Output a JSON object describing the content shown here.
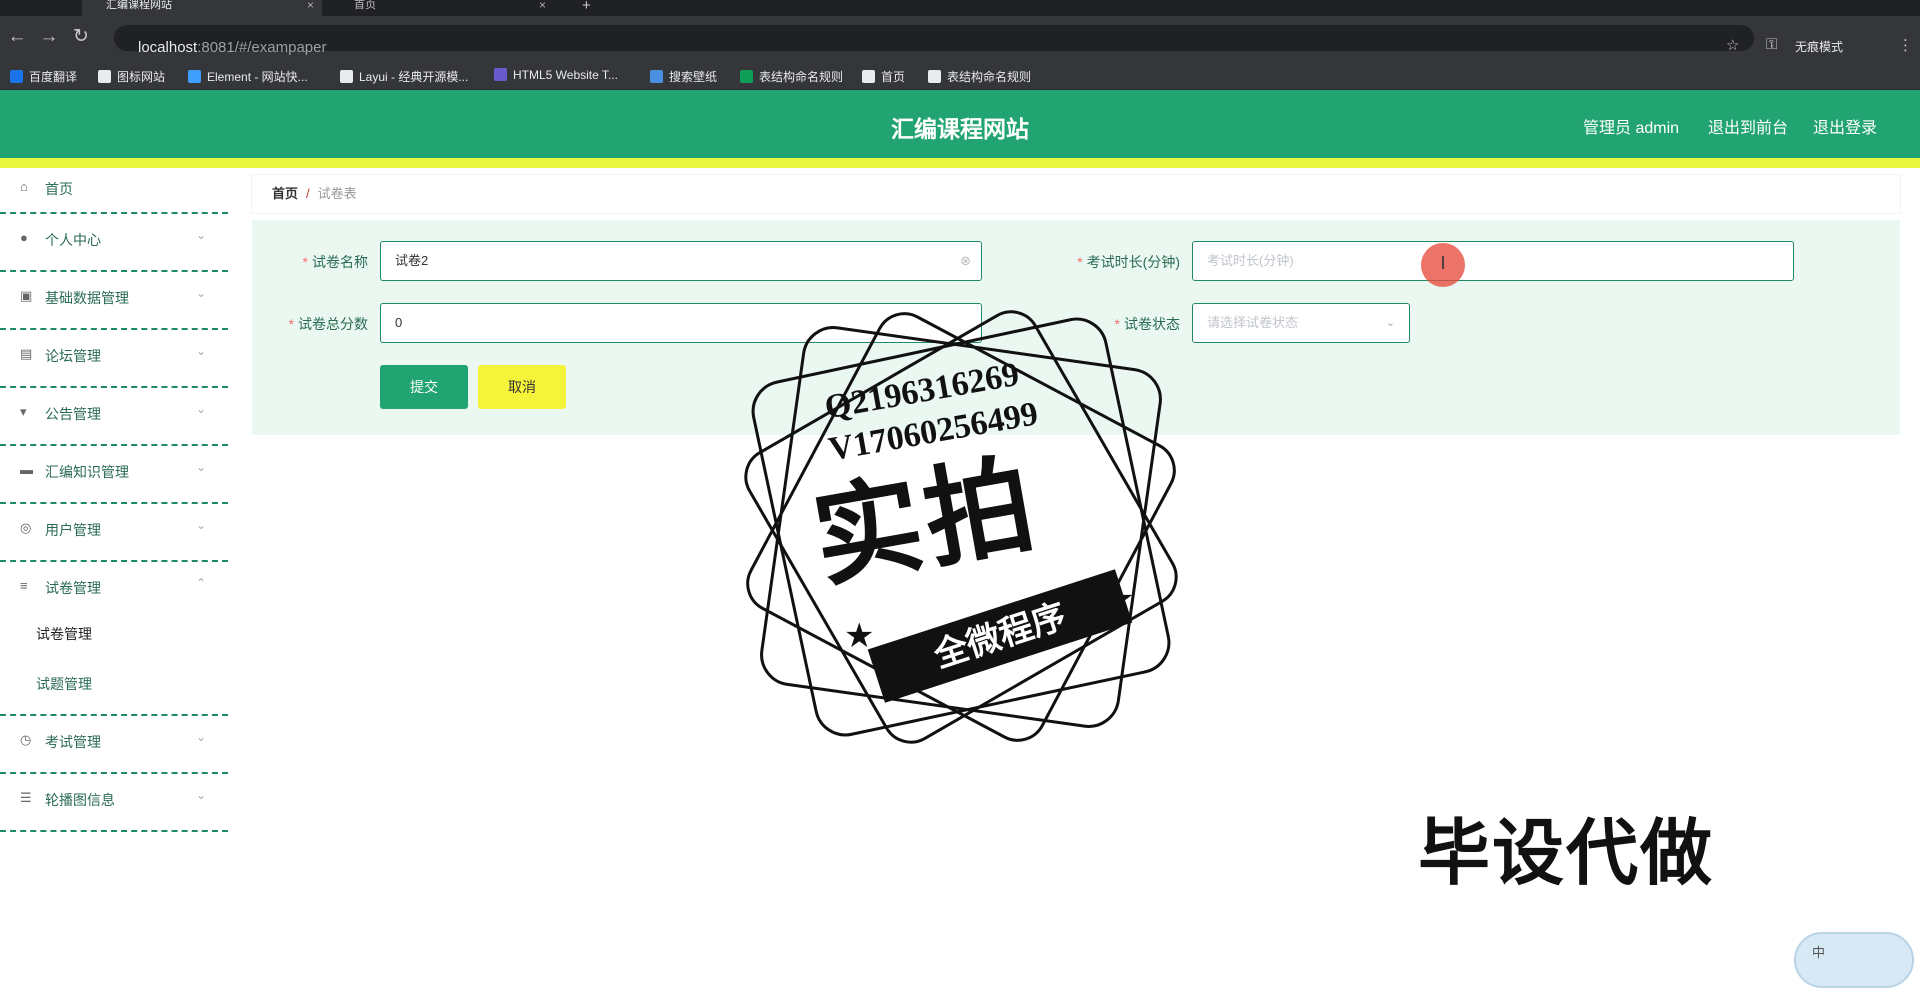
{
  "browser": {
    "tabs": [
      {
        "label": "汇编课程网站",
        "active": true
      },
      {
        "label": "首页",
        "active": false
      }
    ],
    "url_host": "localhost",
    "url_path": ":8081/#/exampaper",
    "incognito_label": "无痕模式",
    "bookmarks": [
      {
        "label": "百度翻译",
        "color": "#1a73e8"
      },
      {
        "label": "图标网站",
        "color": "#e8eaed"
      },
      {
        "label": "Element - 网站快...",
        "color": "#409eff"
      },
      {
        "label": "Layui - 经典开源模...",
        "color": "#e8eaed"
      },
      {
        "label": "HTML5 Website T...",
        "color": "#6a5acd"
      },
      {
        "label": "搜索壁纸",
        "color": "#4a90e2"
      },
      {
        "label": "表结构命名规则",
        "color": "#0f9d58"
      },
      {
        "label": "首页",
        "color": "#e8eaed"
      },
      {
        "label": "表结构命名规则",
        "color": "#e8eaed"
      }
    ]
  },
  "header": {
    "title": "汇编课程网站",
    "admin_label": "管理员 admin",
    "to_front_label": "退出到前台",
    "logout_label": "退出登录",
    "bg_color": "#22a472",
    "strip_color": "#e9f63f"
  },
  "sidebar": {
    "items": [
      {
        "label": "首页",
        "icon": "home-icon"
      },
      {
        "label": "个人中心",
        "icon": "user-icon"
      },
      {
        "label": "基础数据管理",
        "icon": "database-icon"
      },
      {
        "label": "论坛管理",
        "icon": "clipboard-icon"
      },
      {
        "label": "公告管理",
        "icon": "notice-icon"
      },
      {
        "label": "汇编知识管理",
        "icon": "briefcase-icon"
      },
      {
        "label": "用户管理",
        "icon": "globe-icon"
      },
      {
        "label": "试卷管理",
        "icon": "list-icon"
      },
      {
        "label": "考试管理",
        "icon": "clock-icon"
      },
      {
        "label": "轮播图信息",
        "icon": "sliders-icon"
      }
    ],
    "sub_items": [
      "试卷管理",
      "试题管理"
    ]
  },
  "breadcrumb": {
    "home": "首页",
    "separator": "/",
    "current": "试卷表"
  },
  "form": {
    "name_label": "试卷名称",
    "name_value": "试卷2",
    "duration_label": "考试时长(分钟)",
    "duration_placeholder": "考试时长(分钟)",
    "score_label": "试卷总分数",
    "score_value": "0",
    "status_label": "试卷状态",
    "status_placeholder": "请选择试卷状态",
    "submit_label": "提交",
    "cancel_label": "取消"
  },
  "overlay": {
    "qq": "Q2196316269",
    "vx": "V17060256499",
    "big": "实拍",
    "ribbon": "全微程序",
    "bottom": "毕设代做",
    "ime": "中"
  }
}
